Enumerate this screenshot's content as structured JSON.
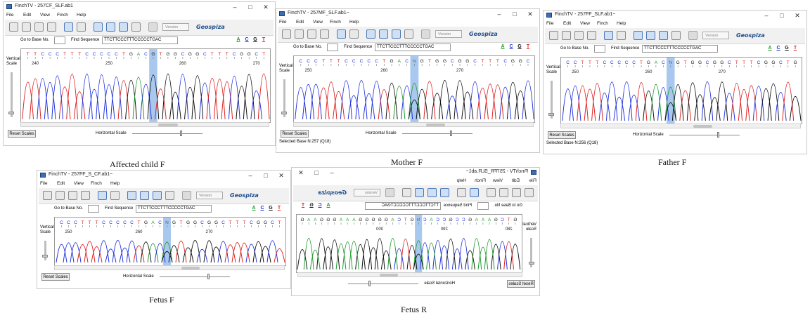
{
  "windows": [
    {
      "id": "affected",
      "title": "FinchTV - 257CF_SLF.ab1",
      "menus": [
        "File",
        "Edit",
        "View",
        "Finch",
        "Help"
      ],
      "go_to_label": "Go to Base No.",
      "find_label": "Find Sequence",
      "find_value": "TTCTTCCCTTTCCCCCTGAC",
      "base_buttons": [
        "A",
        "C",
        "G",
        "T"
      ],
      "vertical_scale_label": "Vertical Scale",
      "reset_label": "Reset Scales",
      "hscale_label": "Horizontal Scale",
      "version_label": "Version",
      "logo": "Geospiza",
      "position_labels": [
        "240",
        "250",
        "260",
        "270"
      ],
      "bases": "TTCCCTTTCCCCCTGACGTGGCGGCTTTCGGCT",
      "highlight_index": 17,
      "status": ""
    },
    {
      "id": "mother",
      "title": "FinchTV - 257MF_SLF.ab1~",
      "menus": [
        "File",
        "Edit",
        "View",
        "Finch",
        "Help"
      ],
      "go_to_label": "Go to Base No.",
      "find_label": "Find Sequence",
      "find_value": "TTCTTCCCTTTCCCCCTGAC",
      "base_buttons": [
        "A",
        "C",
        "G",
        "T"
      ],
      "vertical_scale_label": "Vertical Scale",
      "reset_label": "Reset Scales",
      "hscale_label": "Horizontal Scale",
      "version_label": "Version",
      "logo": "Geospiza",
      "position_labels": [
        "250",
        "260",
        "270"
      ],
      "bases": "CCCTTTCCCCCTGACNGTGGCGGCTTTCGGC",
      "highlight_index": 15,
      "status": "Selected Base N:257  (Q18)"
    },
    {
      "id": "father",
      "title": "FinchTV - 257FF_SLF.ab1~",
      "menus": [
        "File",
        "Edit",
        "View",
        "Finch",
        "Help"
      ],
      "go_to_label": "Go to Base No.",
      "find_label": "Find Sequence",
      "find_value": "TTCTTCCCTTTCCCCCTGAC",
      "base_buttons": [
        "A",
        "C",
        "G",
        "T"
      ],
      "vertical_scale_label": "Vertical Scale",
      "reset_label": "Reset Scales",
      "hscale_label": "Horizontal Scale",
      "version_label": "Version",
      "logo": "Geospiza",
      "position_labels": [
        "250",
        "260",
        "270"
      ],
      "bases": "CCTTTCCCCCTGACNGTGGCGGCTTTCGGCTG",
      "highlight_index": 14,
      "status": "Selected Base N:256  (Q18)"
    },
    {
      "id": "fetus-f",
      "title": "FinchTV - 257FF_S_CF.ab1~",
      "menus": [
        "File",
        "Edit",
        "View",
        "Finch",
        "Help"
      ],
      "go_to_label": "Go to Base No.",
      "find_label": "Find Sequence",
      "find_value": "TTCTTCCCTTTCCCCCTGAC",
      "base_buttons": [
        "A",
        "C",
        "G",
        "T"
      ],
      "vertical_scale_label": "Vertical Scale",
      "reset_label": "Reset Scales",
      "hscale_label": "Horizontal Scale",
      "version_label": "Version",
      "logo": "Geospiza",
      "position_labels": [
        "250",
        "260",
        "270"
      ],
      "bases": "CCCTTTCCCCCTGACNGTGGCGGCTTTCGGCT",
      "highlight_index": 15,
      "status": ""
    },
    {
      "id": "fetus-r",
      "title": "FinchTV - 257FR_SLR.ab1~",
      "menus": [
        "File",
        "Edit",
        "View",
        "Finch",
        "Help"
      ],
      "go_to_label": "Go to Base No.",
      "find_label": "Find Sequence",
      "find_value": "TTCTTCCCTTTCCCCCTGAC",
      "base_buttons": [
        "A",
        "C",
        "G",
        "T"
      ],
      "vertical_scale_label": "Vertical Scale",
      "reset_label": "Reset Scales",
      "hscale_label": "Horizontal Scale",
      "version_label": "Version",
      "logo": "Geospiza",
      "position_labels": [
        "280",
        "290",
        "300"
      ],
      "bases": "GTCGAAAGCCGCCACNGTCAGGGGGAAAGGGAAG",
      "highlight_index": 15,
      "status": ""
    }
  ],
  "captions": {
    "affected": "Affected child F",
    "mother": "Mother F",
    "father": "Father F",
    "fetus_f": "Fetus F",
    "fetus_r": "Fetus R"
  },
  "colors": {
    "A": "#1e9a2c",
    "C": "#2233dd",
    "G": "#111111",
    "T": "#dd2222",
    "N": "#666666",
    "highlight": "#a9c8ef"
  }
}
